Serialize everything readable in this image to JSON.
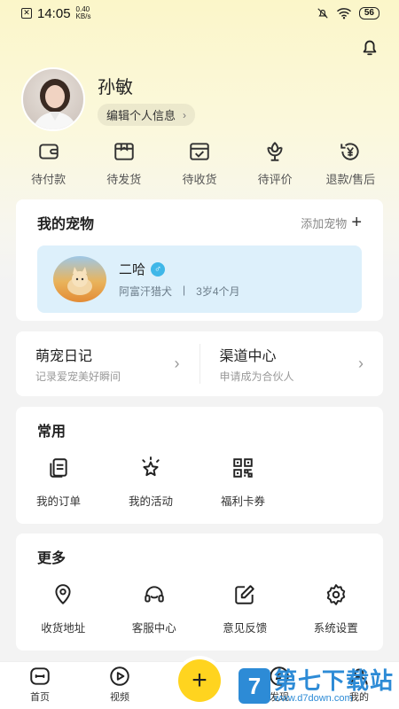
{
  "status_bar": {
    "time": "14:05",
    "speed_value": "0.40",
    "speed_unit": "KB/s",
    "battery": "56"
  },
  "profile": {
    "name": "孙敏",
    "edit_label": "编辑个人信息"
  },
  "orders": [
    {
      "label": "待付款",
      "icon": "wallet-icon"
    },
    {
      "label": "待发货",
      "icon": "package-icon"
    },
    {
      "label": "待收货",
      "icon": "delivery-card-icon"
    },
    {
      "label": "待评价",
      "icon": "flower-icon"
    },
    {
      "label": "退款/售后",
      "icon": "refund-yen-icon"
    }
  ],
  "pets": {
    "title": "我的宠物",
    "add_label": "添加宠物",
    "pet": {
      "name": "二哈",
      "gender_symbol": "♂",
      "breed": "阿富汗猎犬",
      "separator": "|",
      "age": "3岁4个月"
    }
  },
  "links": [
    {
      "title": "萌宠日记",
      "subtitle": "记录爱宠美好瞬间"
    },
    {
      "title": "渠道中心",
      "subtitle": "申请成为合伙人"
    }
  ],
  "common": {
    "title": "常用",
    "items": [
      {
        "label": "我的订单",
        "icon": "order-list-icon"
      },
      {
        "label": "我的活动",
        "icon": "star-activity-icon"
      },
      {
        "label": "福利卡券",
        "icon": "qr-code-icon"
      }
    ]
  },
  "more": {
    "title": "更多",
    "items": [
      {
        "label": "收货地址",
        "icon": "location-pin-icon"
      },
      {
        "label": "客服中心",
        "icon": "headset-icon"
      },
      {
        "label": "意见反馈",
        "icon": "edit-feedback-icon"
      },
      {
        "label": "系统设置",
        "icon": "gear-icon"
      }
    ]
  },
  "tabs": [
    {
      "label": "首页"
    },
    {
      "label": "视频"
    },
    {
      "label": "+"
    },
    {
      "label": "发现"
    },
    {
      "label": "我的"
    }
  ],
  "watermark": {
    "logo": "7",
    "title": "第七下载站",
    "url": "www.d7down.com"
  },
  "colors": {
    "accent": "#ffd41f",
    "pet_box": "#ddf0fb",
    "male_badge": "#3fb7e8"
  }
}
